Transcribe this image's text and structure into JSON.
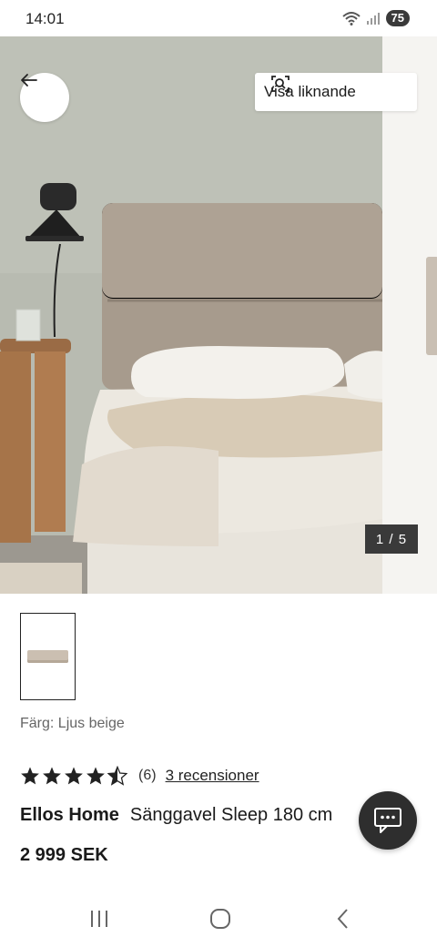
{
  "status_bar": {
    "time": "14:01",
    "battery": "75"
  },
  "hero": {
    "similar_button_label": "Visa liknande",
    "pager": "1 / 5"
  },
  "product": {
    "color_label": "Färg: Ljus beige",
    "rating_value": 4.5,
    "rating_max": 5,
    "rating_count": "(6)",
    "reviews_link": "3 recensioner",
    "brand": "Ellos Home",
    "name": "Sänggavel Sleep 180 cm",
    "price": "2 999 SEK"
  },
  "icons": {
    "back": "arrow-left-icon",
    "similar": "visual-search-icon",
    "chat": "chat-bubble-icon",
    "nav_recents": "recents-icon",
    "nav_home": "home-icon",
    "nav_back": "back-chevron-icon"
  },
  "colors": {
    "wall": "#b9bcb2",
    "headboard": "#a89c8e",
    "accent_dark": "#2e2e2e",
    "star": "#222222"
  }
}
